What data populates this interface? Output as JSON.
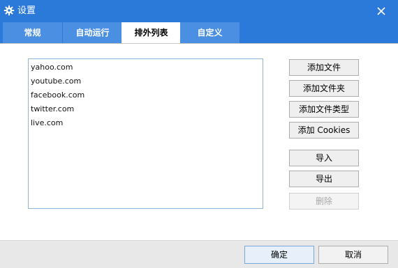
{
  "window": {
    "title": "设置",
    "title_icon": "gear-icon",
    "close_icon": "close-icon"
  },
  "tabs": [
    {
      "label": "常规",
      "active": false
    },
    {
      "label": "自动运行",
      "active": false
    },
    {
      "label": "排外列表",
      "active": true
    },
    {
      "label": "自定义",
      "active": false
    }
  ],
  "exclusion_list": {
    "items": [
      "yahoo.com",
      "youtube.com",
      "facebook.com",
      "twitter.com",
      "live.com"
    ]
  },
  "actions": {
    "add_file": "添加文件",
    "add_folder": "添加文件夹",
    "add_file_type": "添加文件类型",
    "add_cookies": "添加 Cookies",
    "import": "导入",
    "export": "导出",
    "delete": "删除"
  },
  "footer": {
    "ok": "确定",
    "cancel": "取消"
  },
  "colors": {
    "title_bar": "#2b79d9",
    "tab_inactive": "#4a8fe2",
    "tab_active": "#ffffff",
    "list_border": "#8fb3d9",
    "footer_bg": "#e8e8e8"
  }
}
